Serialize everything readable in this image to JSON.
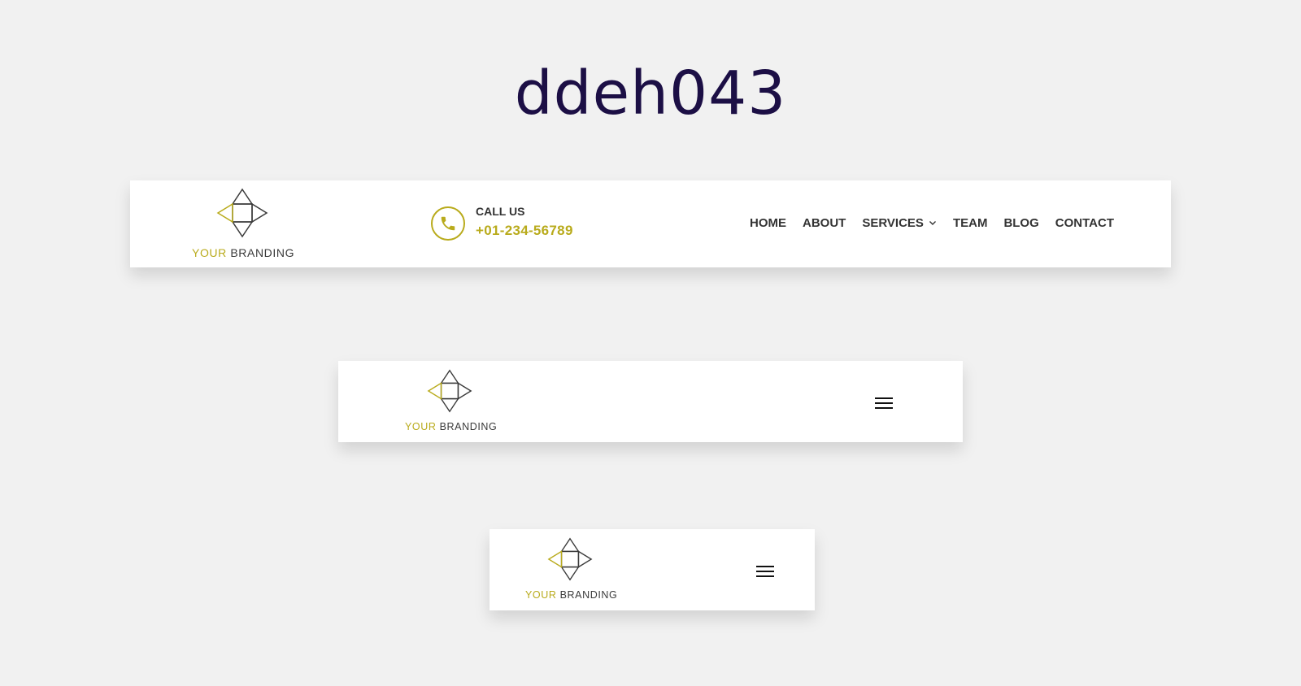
{
  "page": {
    "title": "ddeh043"
  },
  "brand": {
    "word1": "YOUR",
    "word2": "BRANDING",
    "accent_color": "#b9ab1c",
    "dark_color": "#3a3a3a",
    "icon": "diamond-arrows-logo-icon"
  },
  "desktop_header": {
    "call_label": "CALL US",
    "call_number": "+01-234-56789",
    "phone_icon": "phone-icon",
    "nav": [
      {
        "label": "HOME"
      },
      {
        "label": "ABOUT"
      },
      {
        "label": "SERVICES",
        "has_dropdown": true
      },
      {
        "label": "TEAM"
      },
      {
        "label": "BLOG"
      },
      {
        "label": "CONTACT"
      }
    ]
  },
  "tablet_header": {
    "menu_icon": "hamburger-menu-icon"
  },
  "mobile_header": {
    "menu_icon": "hamburger-menu-icon"
  },
  "colors": {
    "background": "#f1f1f1",
    "title": "#1c0f45",
    "card": "#ffffff",
    "nav_text": "#333333"
  }
}
